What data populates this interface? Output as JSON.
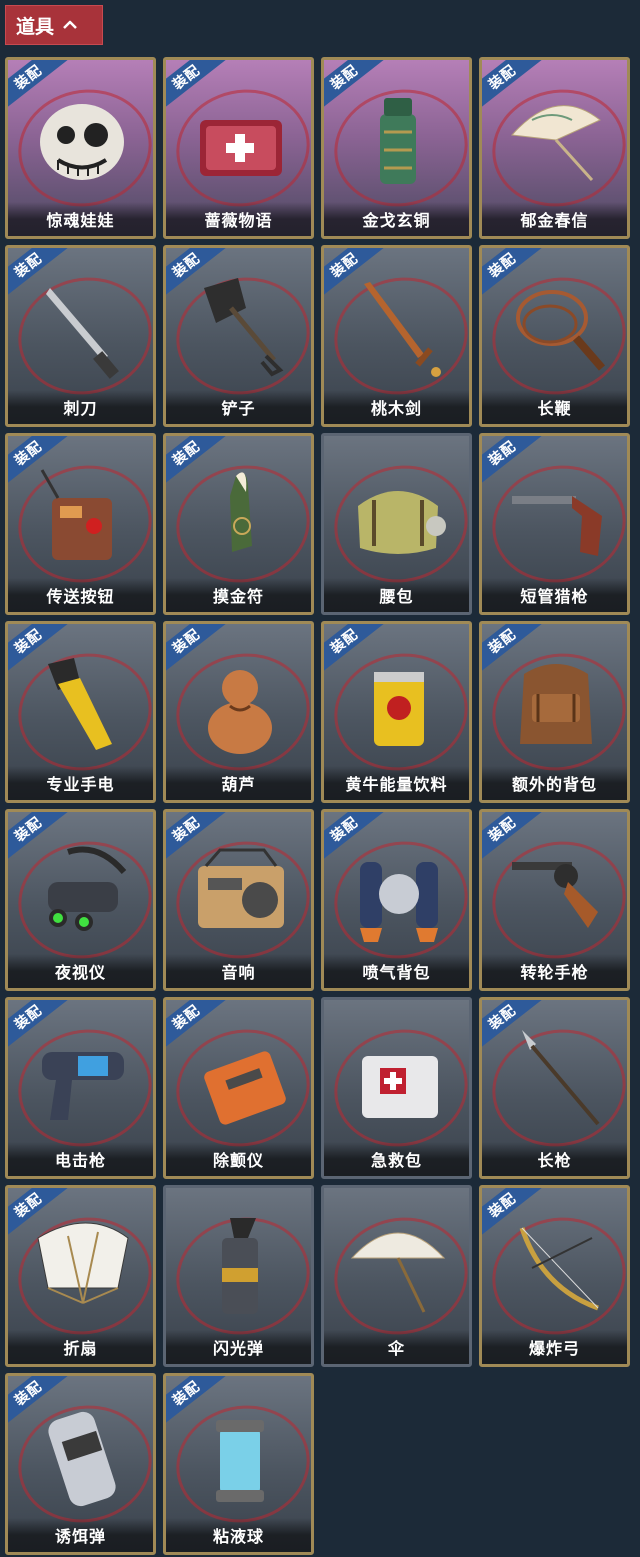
{
  "header": {
    "title": "道具",
    "icon": "chevron-up-icon",
    "color": "#a8333a"
  },
  "equip_badge": "装配",
  "items": [
    {
      "name": "惊魂娃娃",
      "equipped": true,
      "special": true,
      "icon": "skull-doll-icon"
    },
    {
      "name": "蔷薇物语",
      "equipped": true,
      "special": true,
      "icon": "medkit-case-icon"
    },
    {
      "name": "金戈玄铜",
      "equipped": true,
      "special": true,
      "icon": "bronze-grenade-icon"
    },
    {
      "name": "郁金春信",
      "equipped": true,
      "special": true,
      "icon": "parasol-icon"
    },
    {
      "name": "刺刀",
      "equipped": true,
      "special": false,
      "icon": "bayonet-icon"
    },
    {
      "name": "铲子",
      "equipped": true,
      "special": false,
      "icon": "shovel-icon"
    },
    {
      "name": "桃木剑",
      "equipped": true,
      "special": false,
      "icon": "wooden-sword-icon"
    },
    {
      "name": "长鞭",
      "equipped": true,
      "special": false,
      "icon": "whip-icon"
    },
    {
      "name": "传送按钮",
      "equipped": true,
      "special": false,
      "icon": "teleport-remote-icon"
    },
    {
      "name": "摸金符",
      "equipped": true,
      "special": false,
      "icon": "talisman-icon"
    },
    {
      "name": "腰包",
      "equipped": false,
      "special": false,
      "icon": "waist-bag-icon"
    },
    {
      "name": "短管猎枪",
      "equipped": true,
      "special": false,
      "icon": "shotgun-icon"
    },
    {
      "name": "专业手电",
      "equipped": true,
      "special": false,
      "icon": "flashlight-icon"
    },
    {
      "name": "葫芦",
      "equipped": true,
      "special": false,
      "icon": "gourd-icon"
    },
    {
      "name": "黄牛能量饮料",
      "equipped": true,
      "special": false,
      "icon": "energy-drink-icon"
    },
    {
      "name": "额外的背包",
      "equipped": true,
      "special": false,
      "icon": "backpack-icon"
    },
    {
      "name": "夜视仪",
      "equipped": true,
      "special": false,
      "icon": "night-vision-icon"
    },
    {
      "name": "音响",
      "equipped": true,
      "special": false,
      "icon": "radio-icon"
    },
    {
      "name": "喷气背包",
      "equipped": true,
      "special": false,
      "icon": "jetpack-icon"
    },
    {
      "name": "转轮手枪",
      "equipped": true,
      "special": false,
      "icon": "revolver-icon"
    },
    {
      "name": "电击枪",
      "equipped": true,
      "special": false,
      "icon": "shock-gun-icon"
    },
    {
      "name": "除颤仪",
      "equipped": true,
      "special": false,
      "icon": "defibrillator-icon"
    },
    {
      "name": "急救包",
      "equipped": false,
      "special": false,
      "icon": "first-aid-kit-icon"
    },
    {
      "name": "长枪",
      "equipped": true,
      "special": false,
      "icon": "spear-icon"
    },
    {
      "name": "折扇",
      "equipped": true,
      "special": false,
      "icon": "folding-fan-icon"
    },
    {
      "name": "闪光弹",
      "equipped": false,
      "special": false,
      "icon": "flashbang-icon"
    },
    {
      "name": "伞",
      "equipped": false,
      "special": false,
      "icon": "umbrella-icon"
    },
    {
      "name": "爆炸弓",
      "equipped": true,
      "special": false,
      "icon": "bow-icon"
    },
    {
      "name": "诱饵弹",
      "equipped": true,
      "special": false,
      "icon": "decoy-grenade-icon"
    },
    {
      "name": "粘液球",
      "equipped": true,
      "special": false,
      "icon": "slime-capsule-icon"
    }
  ]
}
